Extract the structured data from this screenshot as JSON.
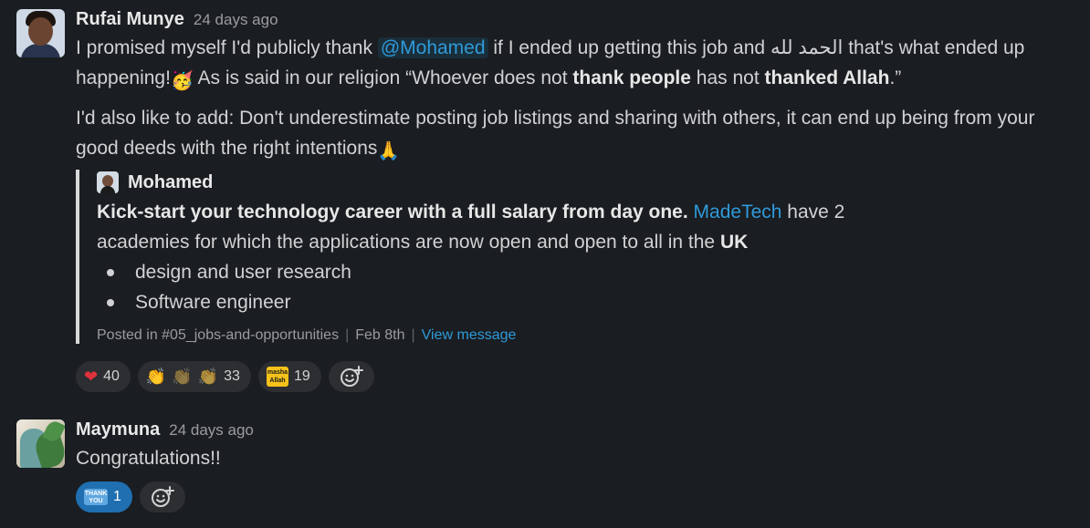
{
  "messages": [
    {
      "author": "Rufai Munye",
      "time": "24 days ago",
      "line1_a": "I promised myself I'd publicly thank",
      "mention": "@Mohamed",
      "line1_b": "if I ended up getting this job and",
      "arabic": "الحمد لله",
      "line1_c": "that's what ended up happening!",
      "line1_d": "As is said in our religion “Whoever does not",
      "bold1": "thank people",
      "line1_e": "has not",
      "bold2": "thanked Allah",
      "line1_f": ".”",
      "para2": "I'd also like to add: Don't underestimate posting job listings and sharing with others, it can end up being from your good deeds with the right intentions",
      "quote": {
        "author": "Mohamed",
        "bold": "Kick-start your technology career with a full salary from day one.",
        "link": "MadeTech",
        "text_a": "have 2 academies for which the applications are now open and open to all in the",
        "bold_uk": "UK",
        "bullets": [
          "design and user research",
          "Software engineer"
        ],
        "posted_in": "Posted in #05_jobs-and-opportunities",
        "date": "Feb 8th",
        "view": "View message"
      },
      "reactions": [
        {
          "emoji": "heart-emoji",
          "count": "40"
        },
        {
          "emoji": "clapping-hands-emoji",
          "count": "33"
        },
        {
          "emoji": "masha-allah-emoji",
          "count": "19",
          "label": "masha Allah"
        }
      ]
    },
    {
      "author": "Maymuna",
      "time": "24 days ago",
      "text": "Congratulations!!",
      "reactions": [
        {
          "emoji": "thank-you-emoji",
          "count": "1",
          "label": "THANK YOU"
        }
      ]
    }
  ],
  "colors": {
    "background": "#1a1d21",
    "link": "#2f9ad8",
    "active_reaction": "#1f6fb1"
  }
}
